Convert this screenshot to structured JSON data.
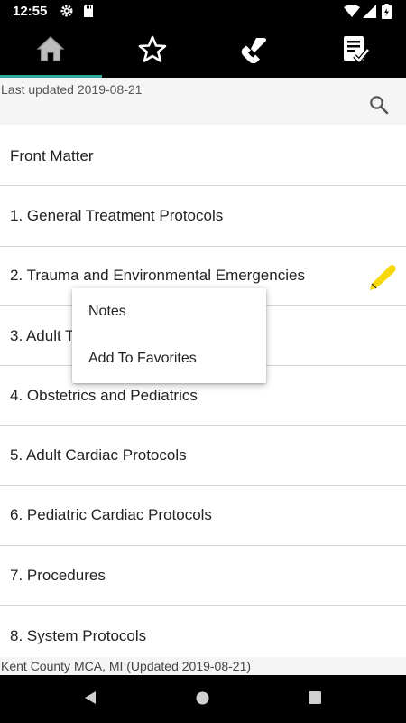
{
  "status_bar": {
    "time": "12:55",
    "icons": [
      "gear-icon",
      "sd-card-icon",
      "wifi-icon",
      "signal-icon",
      "battery-icon"
    ]
  },
  "top_nav": {
    "tabs": [
      {
        "icon": "home-icon",
        "active": true
      },
      {
        "icon": "star-icon",
        "active": false
      },
      {
        "icon": "phone-icon",
        "active": false
      },
      {
        "icon": "checklist-icon",
        "active": false
      }
    ],
    "accent_color": "#2fa8a0"
  },
  "header": {
    "last_updated": "Last updated 2019-08-21",
    "search_icon": "search-icon"
  },
  "chapters": [
    {
      "label": "Front Matter"
    },
    {
      "label": "1. General Treatment Protocols"
    },
    {
      "label": "2. Trauma and Environmental Emergencies",
      "has_note": true
    },
    {
      "label": "3. Adult Treatment Protocols"
    },
    {
      "label": "4. Obstetrics and Pediatrics"
    },
    {
      "label": "5. Adult Cardiac Protocols"
    },
    {
      "label": "6. Pediatric Cardiac Protocols"
    },
    {
      "label": "7. Procedures"
    },
    {
      "label": "8. System Protocols"
    }
  ],
  "context_menu": {
    "items": [
      {
        "label": "Notes"
      },
      {
        "label": "Add To Favorites"
      }
    ]
  },
  "footer": {
    "text": "Kent County MCA, MI (Updated 2019-08-21)"
  },
  "note_color": "#f5d90a"
}
